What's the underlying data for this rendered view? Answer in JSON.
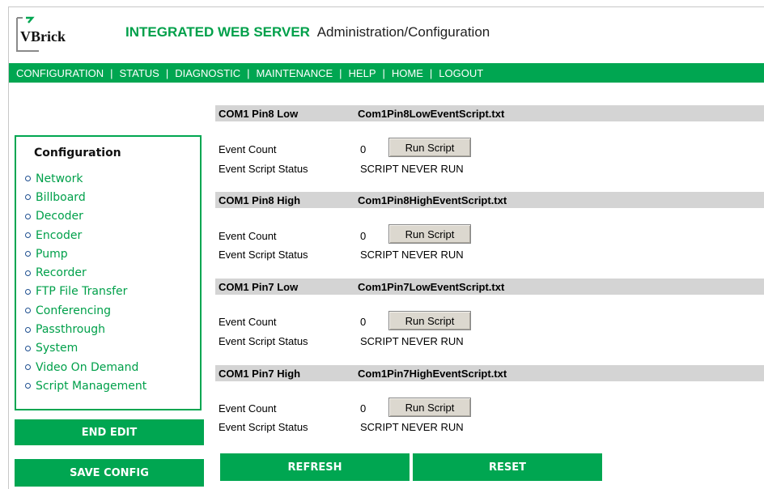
{
  "header": {
    "logo_text": "VBrick",
    "brand": "INTEGRATED WEB SERVER",
    "subtitle": "Administration/Configuration"
  },
  "nav": {
    "items": [
      "CONFIGURATION",
      "STATUS",
      "DIAGNOSTIC",
      "MAINTENANCE",
      "HELP",
      "HOME",
      "LOGOUT"
    ]
  },
  "sidebar": {
    "title": "Configuration",
    "items": [
      "Network",
      "Billboard",
      "Decoder",
      "Encoder",
      "Pump",
      "Recorder",
      "FTP File Transfer",
      "Conferencing",
      "Passthrough",
      "System",
      "Video On Demand",
      "Script Management"
    ],
    "end_edit": "END EDIT",
    "save_config": "SAVE CONFIG"
  },
  "events": [
    {
      "pin": "COM1 Pin8 Low",
      "file": "Com1Pin8LowEventScript.txt",
      "count_label": "Event Count",
      "count": "0",
      "status_label": "Event Script Status",
      "status": "SCRIPT NEVER RUN",
      "button": "Run Script"
    },
    {
      "pin": "COM1 Pin8 High",
      "file": "Com1Pin8HighEventScript.txt",
      "count_label": "Event Count",
      "count": "0",
      "status_label": "Event Script Status",
      "status": "SCRIPT NEVER RUN",
      "button": "Run Script"
    },
    {
      "pin": "COM1 Pin7 Low",
      "file": "Com1Pin7LowEventScript.txt",
      "count_label": "Event Count",
      "count": "0",
      "status_label": "Event Script Status",
      "status": "SCRIPT NEVER RUN",
      "button": "Run Script"
    },
    {
      "pin": "COM1 Pin7 High",
      "file": "Com1Pin7HighEventScript.txt",
      "count_label": "Event Count",
      "count": "0",
      "status_label": "Event Script Status",
      "status": "SCRIPT NEVER RUN",
      "button": "Run Script"
    }
  ],
  "actions": {
    "refresh": "REFRESH",
    "reset": "RESET"
  },
  "colors": {
    "accent_green": "#00a651",
    "header_gray": "#d4d4d4",
    "button_face": "#dcd8cf"
  }
}
